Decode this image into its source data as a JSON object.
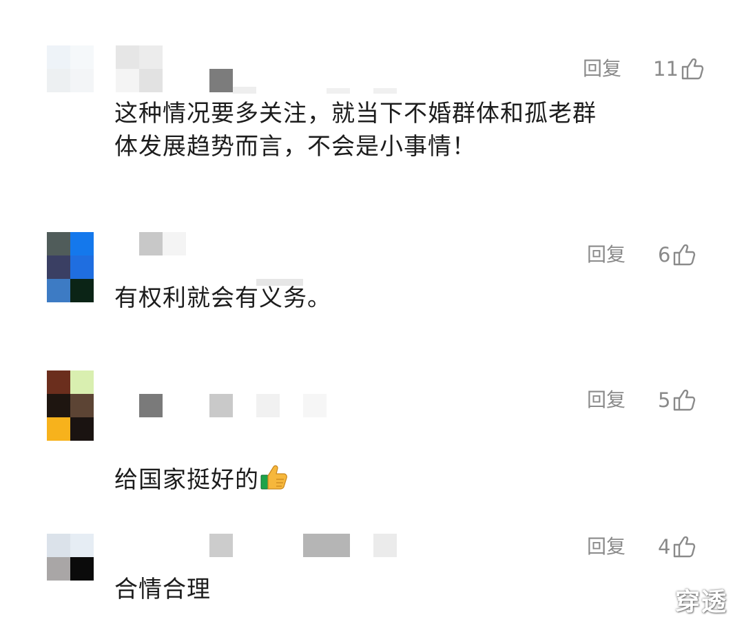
{
  "comments": [
    {
      "text": "这种情况要多关注，就当下不婚群体和孤老群\n体发展趋势而言，不会是小事情！",
      "reply_label": "回复",
      "likes": "11"
    },
    {
      "text": "有权利就会有义务。",
      "reply_label": "回复",
      "likes": "6"
    },
    {
      "text": "给国家挺好的",
      "reply_label": "回复",
      "likes": "5",
      "trailing_emoji": "thumbs-up-emoji"
    },
    {
      "text": "合情合理",
      "reply_label": "回复",
      "likes": "4"
    }
  ],
  "watermark": "穿透",
  "icons": {
    "like": "thumbs-up-outline-icon"
  },
  "colors": {
    "secondary_text": "#8a8a8a",
    "body_text": "#1c1c1c"
  }
}
